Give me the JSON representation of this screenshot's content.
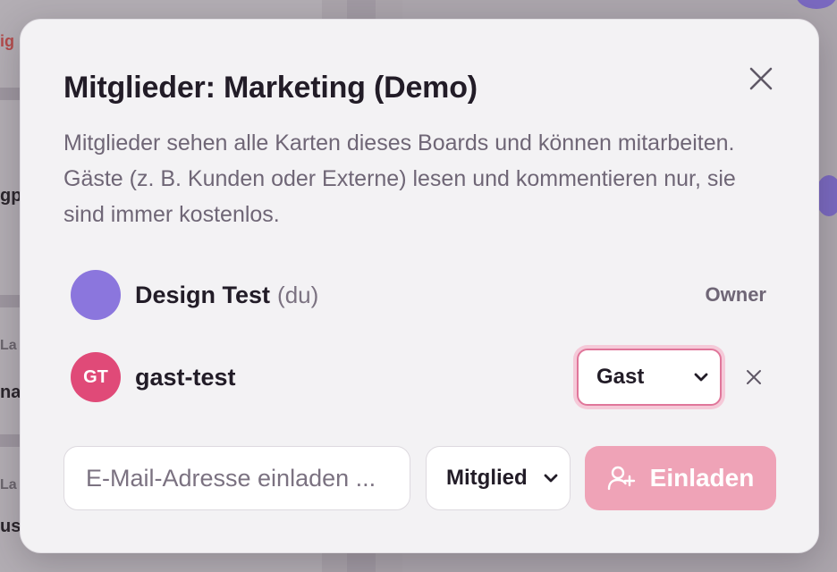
{
  "modal": {
    "title": "Mitglieder: Marketing (Demo)",
    "description": "Mitglieder sehen alle Karten dieses Boards und können mitarbeiten. Gäste (z. B. Kunden oder Externe) lesen und kommentieren nur, sie sind immer kostenlos.",
    "close_icon": "close-icon"
  },
  "members": [
    {
      "name": "Design Test",
      "you_label": "(du)",
      "role": "Owner",
      "avatar_color": "#8b76dd"
    },
    {
      "initials": "GT",
      "name": "gast-test",
      "role": "Gast",
      "avatar_color": "#e04a78",
      "remove_icon": "close-icon"
    }
  ],
  "invite": {
    "email_placeholder": "E-Mail-Adresse einladen ...",
    "email_value": "",
    "role": "Mitglied",
    "button_label": "Einladen",
    "button_icon": "user-plus-icon",
    "button_color": "#efa3b7"
  },
  "background": {
    "left_fragments": [
      "ig",
      "gp",
      "La",
      "na",
      "La",
      "us"
    ]
  },
  "colors": {
    "accent": "#e04a78",
    "focus_ring": "#f5c9d8",
    "text_primary": "#221c27",
    "text_secondary": "#6f6676"
  }
}
